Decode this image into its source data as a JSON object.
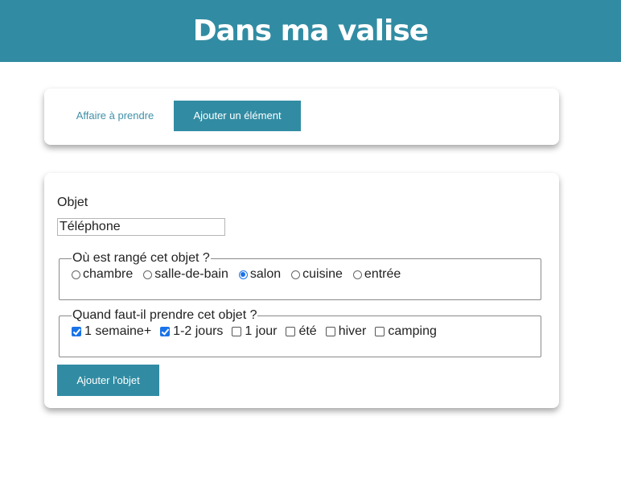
{
  "header": {
    "title": "Dans ma valise"
  },
  "nav": {
    "tabs": [
      {
        "label": "Affaire à prendre",
        "active": false
      },
      {
        "label": "Ajouter un élément",
        "active": true
      }
    ]
  },
  "form": {
    "object_label": "Objet",
    "object_value": "Téléphone",
    "location": {
      "legend": "Où est rangé cet objet ?",
      "options": [
        "chambre",
        "salle-de-bain",
        "salon",
        "cuisine",
        "entrée"
      ],
      "selected": "salon"
    },
    "timing": {
      "legend": "Quand faut-il prendre cet objet ?",
      "options": [
        "1 semaine+",
        "1-2 jours",
        "1 jour",
        "été",
        "hiver",
        "camping"
      ],
      "checked": [
        "1 semaine+",
        "1-2 jours"
      ]
    },
    "submit_label": "Ajouter l'objet"
  },
  "colors": {
    "accent": "#318ca3",
    "control_blue": "#1a73e8"
  }
}
